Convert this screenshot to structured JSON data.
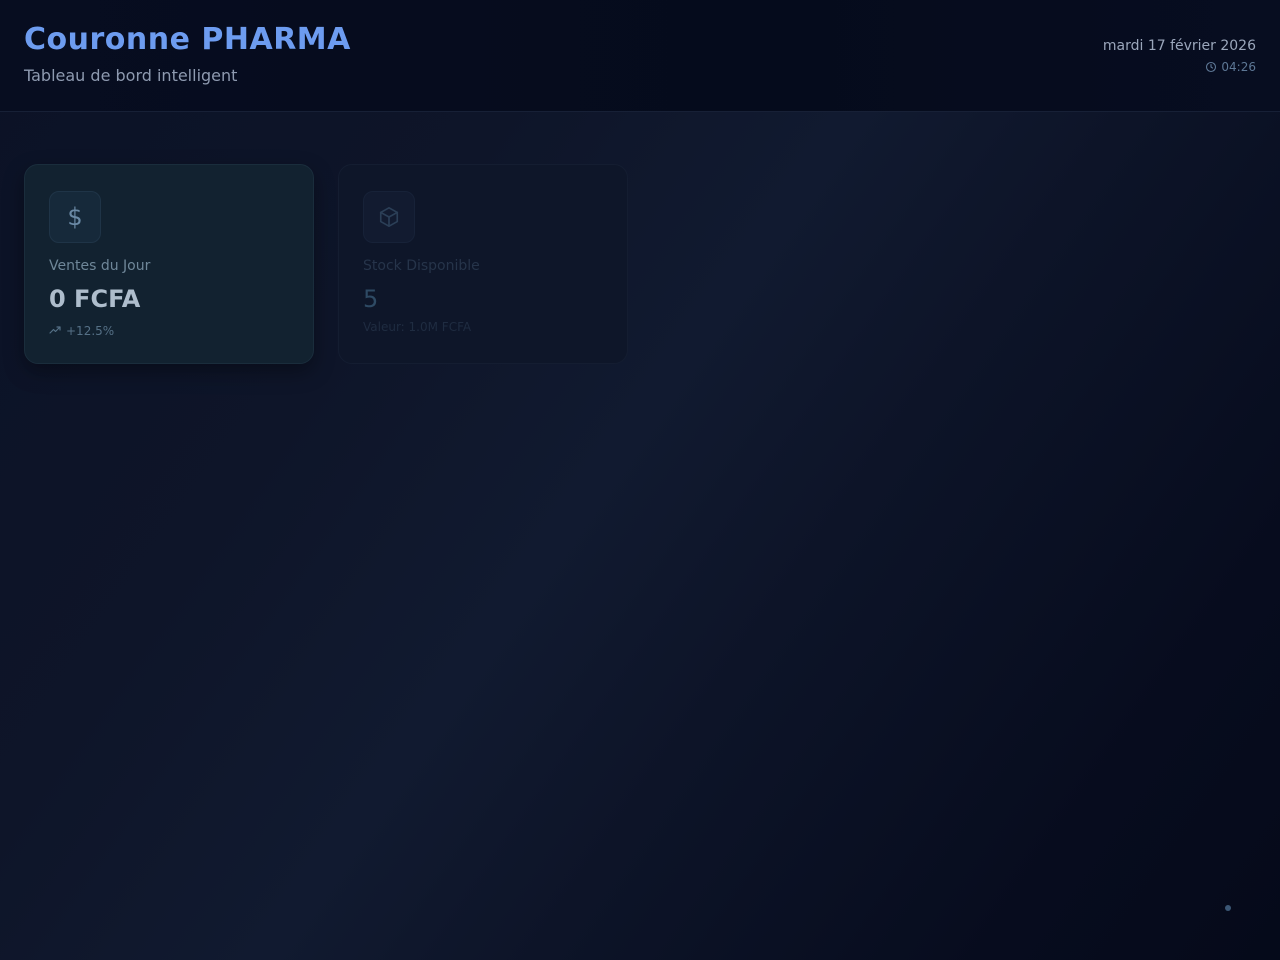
{
  "header": {
    "title": "Couronne PHARMA",
    "subtitle": "Tableau de bord intelligent",
    "date": "mardi 17 février 2026",
    "time": "04:26",
    "time_icon": "clock-icon"
  },
  "cards": {
    "sales": {
      "icon": "dollar-icon",
      "icon_glyph": "$",
      "label": "Ventes du Jour",
      "value": "0 FCFA",
      "trend_icon": "trending-up-icon",
      "trend": "+12.5%"
    },
    "stock": {
      "icon": "box-icon",
      "label": "Stock Disponible",
      "value": "5",
      "meta": "Valeur: 1.0M FCFA"
    }
  },
  "colors": {
    "brand": "#6d9cf0",
    "background": "#0b1226",
    "card_active": "#122230"
  }
}
